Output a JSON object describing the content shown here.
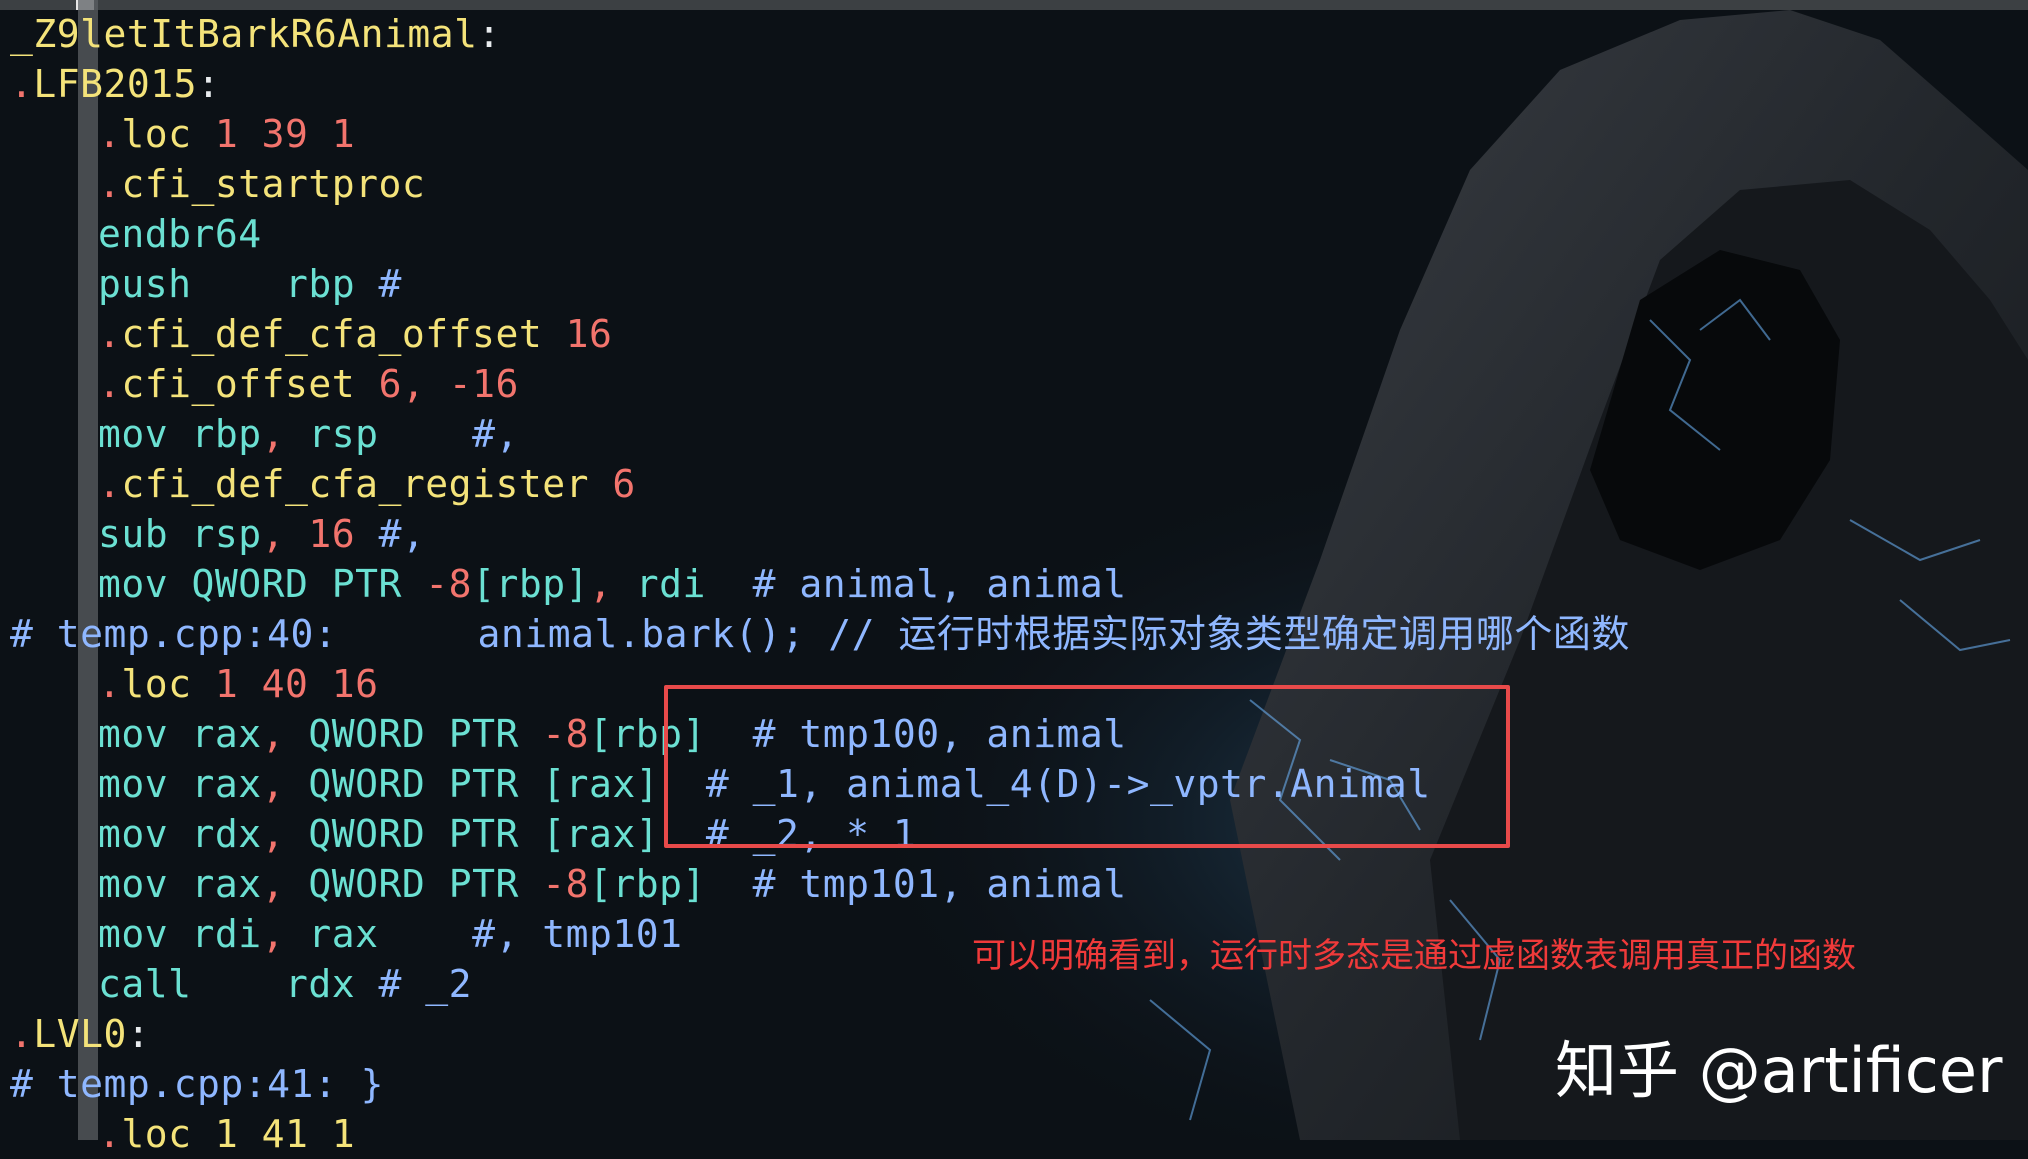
{
  "code_lines": [
    {
      "indent": false,
      "segments": [
        {
          "t": "_Z9letItBarkR6Animal",
          "c": "c-label"
        },
        {
          "t": ":",
          "c": "c-white"
        }
      ]
    },
    {
      "indent": false,
      "segments": [
        {
          "t": ".",
          "c": "c-dot"
        },
        {
          "t": "LFB2015",
          "c": "c-label"
        },
        {
          "t": ":",
          "c": "c-white"
        }
      ]
    },
    {
      "indent": true,
      "segments": [
        {
          "t": ".",
          "c": "c-dot"
        },
        {
          "t": "loc ",
          "c": "c-dir"
        },
        {
          "t": "1 39 1",
          "c": "c-num"
        }
      ]
    },
    {
      "indent": true,
      "segments": [
        {
          "t": ".",
          "c": "c-dot"
        },
        {
          "t": "cfi_startproc",
          "c": "c-dir"
        }
      ]
    },
    {
      "indent": true,
      "segments": [
        {
          "t": "endbr64",
          "c": "c-ins"
        }
      ]
    },
    {
      "indent": true,
      "segments": [
        {
          "t": "push    rbp ",
          "c": "c-ins"
        },
        {
          "t": "#",
          "c": "c-cmt"
        }
      ]
    },
    {
      "indent": true,
      "segments": [
        {
          "t": ".",
          "c": "c-dot"
        },
        {
          "t": "cfi_def_cfa_offset ",
          "c": "c-dir"
        },
        {
          "t": "16",
          "c": "c-num"
        }
      ]
    },
    {
      "indent": true,
      "segments": [
        {
          "t": ".",
          "c": "c-dot"
        },
        {
          "t": "cfi_offset ",
          "c": "c-dir"
        },
        {
          "t": "6, -16",
          "c": "c-num"
        }
      ]
    },
    {
      "indent": true,
      "segments": [
        {
          "t": "mov rbp",
          "c": "c-ins"
        },
        {
          "t": ", ",
          "c": "c-num"
        },
        {
          "t": "rsp    ",
          "c": "c-ins"
        },
        {
          "t": "#,",
          "c": "c-cmt"
        }
      ]
    },
    {
      "indent": true,
      "segments": [
        {
          "t": ".",
          "c": "c-dot"
        },
        {
          "t": "cfi_def_cfa_register ",
          "c": "c-dir"
        },
        {
          "t": "6",
          "c": "c-num"
        }
      ]
    },
    {
      "indent": true,
      "segments": [
        {
          "t": "sub rsp",
          "c": "c-ins"
        },
        {
          "t": ", ",
          "c": "c-num"
        },
        {
          "t": "16 ",
          "c": "c-num"
        },
        {
          "t": "#,",
          "c": "c-cmt"
        }
      ]
    },
    {
      "indent": true,
      "segments": [
        {
          "t": "mov QWORD PTR ",
          "c": "c-ins"
        },
        {
          "t": "-8",
          "c": "c-num"
        },
        {
          "t": "[rbp]",
          "c": "c-ins"
        },
        {
          "t": ", ",
          "c": "c-num"
        },
        {
          "t": "rdi  ",
          "c": "c-ins"
        },
        {
          "t": "# animal, animal",
          "c": "c-cmt"
        }
      ]
    },
    {
      "indent": false,
      "segments": [
        {
          "t": "# temp.cpp:40:      animal.bark(); // 运行时根据实际对象类型确定调用哪个函数",
          "c": "c-cmt"
        }
      ]
    },
    {
      "indent": true,
      "segments": [
        {
          "t": ".",
          "c": "c-dot"
        },
        {
          "t": "loc ",
          "c": "c-dir"
        },
        {
          "t": "1 40 16",
          "c": "c-num"
        }
      ]
    },
    {
      "indent": true,
      "segments": [
        {
          "t": "mov rax",
          "c": "c-ins"
        },
        {
          "t": ", ",
          "c": "c-num"
        },
        {
          "t": "QWORD PTR ",
          "c": "c-ins"
        },
        {
          "t": "-8",
          "c": "c-num"
        },
        {
          "t": "[rbp]  ",
          "c": "c-ins"
        },
        {
          "t": "# tmp100, animal",
          "c": "c-cmt"
        }
      ]
    },
    {
      "indent": true,
      "segments": [
        {
          "t": "mov rax",
          "c": "c-ins"
        },
        {
          "t": ", ",
          "c": "c-num"
        },
        {
          "t": "QWORD PTR [rax]  ",
          "c": "c-ins"
        },
        {
          "t": "# _1, animal_4(D)->_vptr.Animal",
          "c": "c-cmt"
        }
      ]
    },
    {
      "indent": true,
      "segments": [
        {
          "t": "mov rdx",
          "c": "c-ins"
        },
        {
          "t": ", ",
          "c": "c-num"
        },
        {
          "t": "QWORD PTR [rax]  ",
          "c": "c-ins"
        },
        {
          "t": "# _2, * 1",
          "c": "c-cmt"
        }
      ]
    },
    {
      "indent": true,
      "segments": [
        {
          "t": "mov rax",
          "c": "c-ins"
        },
        {
          "t": ", ",
          "c": "c-num"
        },
        {
          "t": "QWORD PTR ",
          "c": "c-ins"
        },
        {
          "t": "-8",
          "c": "c-num"
        },
        {
          "t": "[rbp]  ",
          "c": "c-ins"
        },
        {
          "t": "# tmp101, animal",
          "c": "c-cmt"
        }
      ]
    },
    {
      "indent": true,
      "segments": [
        {
          "t": "mov rdi",
          "c": "c-ins"
        },
        {
          "t": ", ",
          "c": "c-num"
        },
        {
          "t": "rax    ",
          "c": "c-ins"
        },
        {
          "t": "#, tmp101",
          "c": "c-cmt"
        }
      ]
    },
    {
      "indent": true,
      "segments": [
        {
          "t": "call    rdx ",
          "c": "c-ins"
        },
        {
          "t": "# _2",
          "c": "c-cmt"
        }
      ]
    },
    {
      "indent": false,
      "segments": [
        {
          "t": ".",
          "c": "c-dot"
        },
        {
          "t": "LVL0",
          "c": "c-label"
        },
        {
          "t": ":",
          "c": "c-white"
        }
      ]
    },
    {
      "indent": false,
      "segments": [
        {
          "t": "# temp.cpp:41: }",
          "c": "c-cmt"
        }
      ]
    },
    {
      "indent": true,
      "segments": [
        {
          "t": ".",
          "c": "c-dot"
        },
        {
          "t": "loc 1 41 1",
          "c": "c-dir"
        }
      ]
    }
  ],
  "annotation": "可以明确看到，运行时多态是通过虚函数表调用真正的函数",
  "watermark": "知乎 @artificer",
  "colors": {
    "label": "#f4e37a",
    "directive_dot": "#f2746d",
    "instruction": "#6be0d2",
    "number": "#f2746d",
    "comment": "#8fb7ff",
    "highlight_box": "#e84a4a",
    "annotation": "#f03a3a"
  }
}
